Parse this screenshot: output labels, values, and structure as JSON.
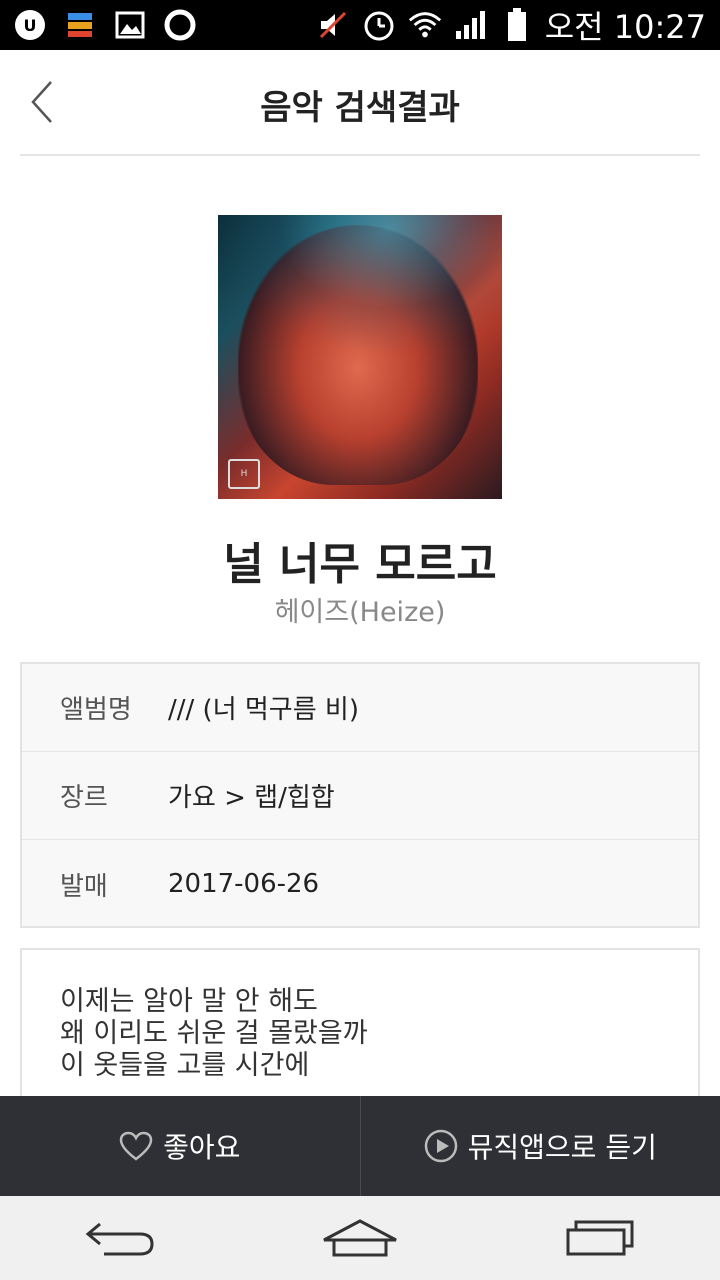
{
  "status_bar": {
    "time": "오전 10:27",
    "icons": [
      "uplus-icon",
      "app-grid-icon",
      "gallery-icon",
      "circle-record-icon",
      "mute-icon",
      "alarm-icon",
      "wifi-icon",
      "signal-icon",
      "battery-icon"
    ]
  },
  "header": {
    "title": "음악 검색결과",
    "back_icon": "chevron-left-icon"
  },
  "song": {
    "title": "널 너무 모르고",
    "artist": "헤이즈(Heize)"
  },
  "info": {
    "rows": [
      {
        "label": "앨범명",
        "value": "/// (너 먹구름 비)"
      },
      {
        "label": "장르",
        "value": "가요 > 랩/힙합"
      },
      {
        "label": "발매",
        "value": "2017-06-26"
      }
    ]
  },
  "lyrics": {
    "lines": [
      "이제는 알아 말 안 해도",
      "왜 이리도 쉬운 걸 몰랐을까",
      "이 옷들을 고를 시간에"
    ]
  },
  "actions": {
    "like_label": "좋아요",
    "listen_label": "뮤직앱으로 듣기"
  },
  "colors": {
    "action_bar_bg": "#2f3035",
    "nav_bar_bg": "#f0f0f0"
  }
}
